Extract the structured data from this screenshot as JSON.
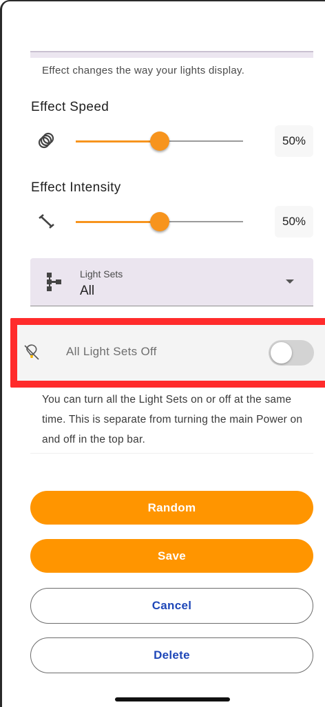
{
  "effect": {
    "helper_text": "Effect changes the way your lights display."
  },
  "effect_speed": {
    "title": "Effect Speed",
    "icon": "rings-icon",
    "value_percent": 50,
    "value_label": "50%"
  },
  "effect_intensity": {
    "title": "Effect Intensity",
    "icon": "dumbbell-icon",
    "value_percent": 50,
    "value_label": "50%"
  },
  "light_sets": {
    "label": "Light Sets",
    "selected": "All",
    "icon": "tree-structure-icon"
  },
  "all_off": {
    "label": "All Light Sets Off",
    "icon": "light-bulb-off-icon",
    "toggle_on": false,
    "description": "You can turn all the Light Sets on or off at the same time. This is separate from turning the main Power on and off in the top bar."
  },
  "buttons": {
    "random": "Random",
    "save": "Save",
    "cancel": "Cancel",
    "delete": "Delete"
  },
  "colors": {
    "accent": "#ff9500",
    "slider": "#f7941d",
    "link_blue": "#1e47b8",
    "highlight_red": "#ff2b2b"
  }
}
